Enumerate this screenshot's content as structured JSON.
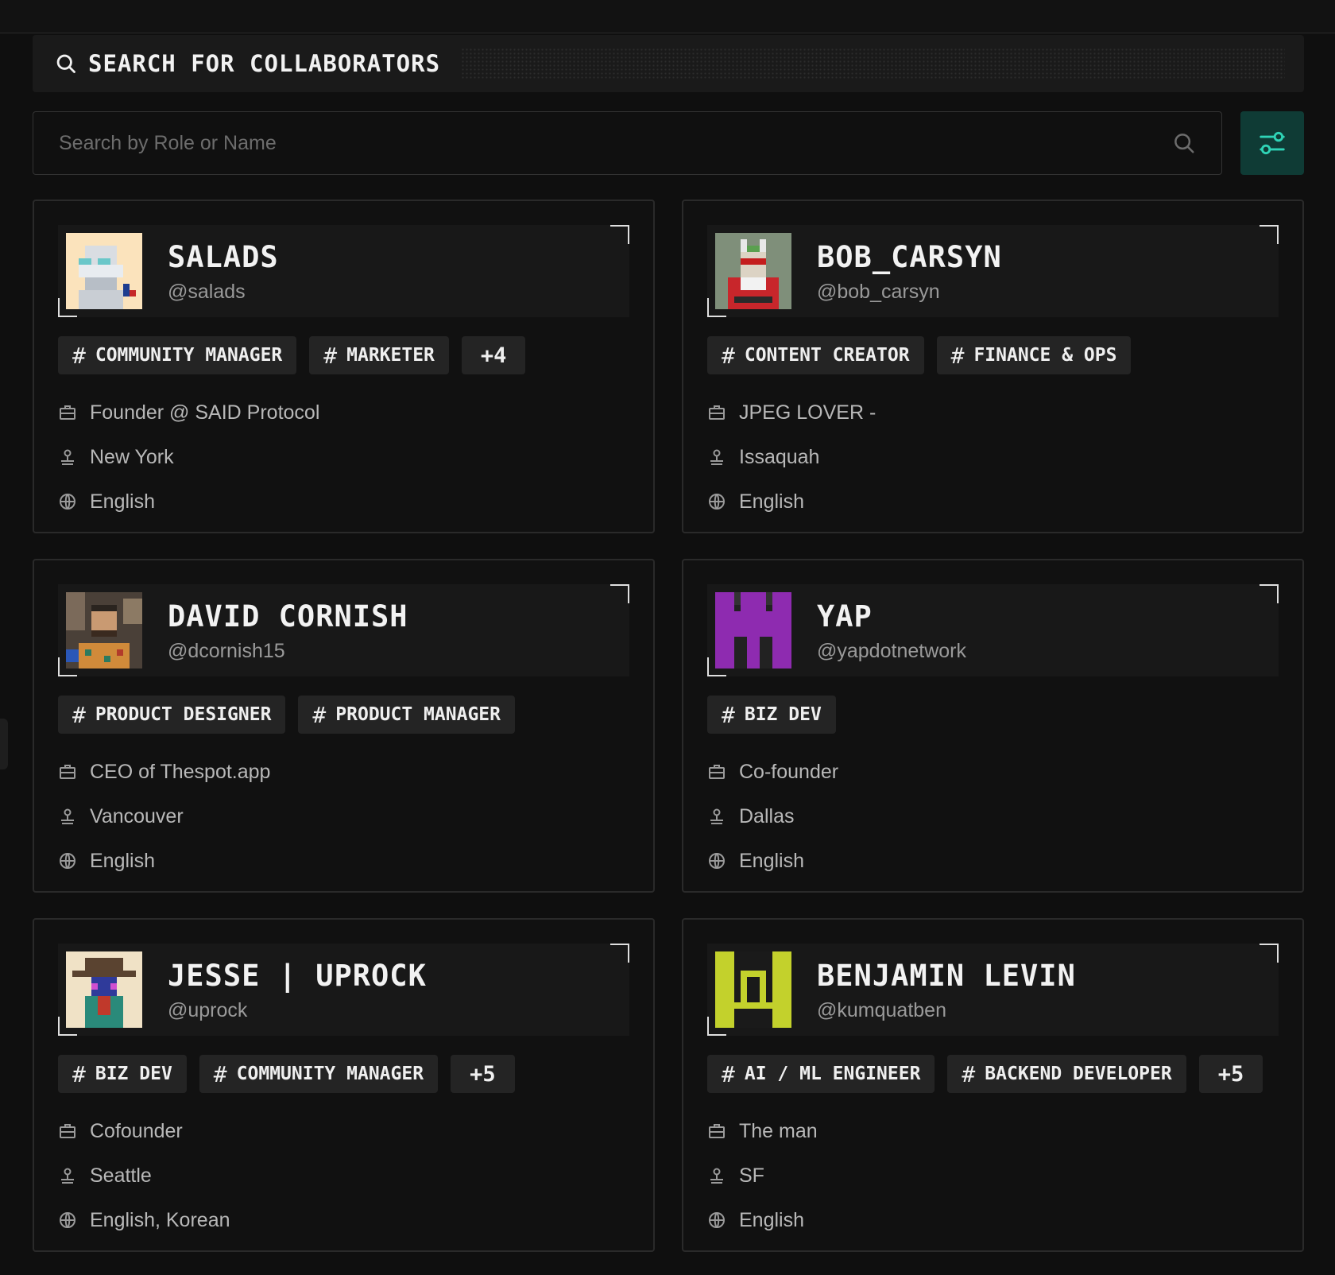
{
  "header": {
    "title": "SEARCH FOR COLLABORATORS",
    "icon": "search-icon"
  },
  "search": {
    "placeholder": "Search by Role or Name",
    "value": "",
    "icon": "search-icon"
  },
  "filter_button": {
    "icon": "sliders-icon",
    "color": "#0f3b35",
    "icon_color": "#2fd3b6"
  },
  "colors": {
    "background": "#0f0f0f",
    "card_border": "#2a2a2a",
    "tag_background": "#242424",
    "accent": "#0f3b35"
  },
  "cards": [
    {
      "name": "SALADS",
      "handle": "@salads",
      "tags": [
        "COMMUNITY MANAGER",
        "MARKETER"
      ],
      "more": "+4",
      "title": "Founder @ SAID Protocol",
      "location": "New York",
      "languages": "English"
    },
    {
      "name": "BOB_CARSYN",
      "handle": "@bob_carsyn",
      "tags": [
        "CONTENT CREATOR",
        "FINANCE & OPS"
      ],
      "more": "",
      "title": "JPEG LOVER -",
      "location": "Issaquah",
      "languages": "English"
    },
    {
      "name": "DAVID CORNISH",
      "handle": "@dcornish15",
      "tags": [
        "PRODUCT DESIGNER",
        "PRODUCT MANAGER"
      ],
      "more": "",
      "title": "CEO of Thespot.app",
      "location": "Vancouver",
      "languages": "English"
    },
    {
      "name": "YAP",
      "handle": "@yapdotnetwork",
      "tags": [
        "BIZ DEV"
      ],
      "more": "",
      "title": "Co-founder",
      "location": "Dallas",
      "languages": "English"
    },
    {
      "name": "JESSE | UPROCK",
      "handle": "@uprock",
      "tags": [
        "BIZ DEV",
        "COMMUNITY MANAGER"
      ],
      "more": "+5",
      "title": "Cofounder",
      "location": "Seattle",
      "languages": "English, Korean"
    },
    {
      "name": "BENJAMIN LEVIN",
      "handle": "@kumquatben",
      "tags": [
        "AI / ML ENGINEER",
        "BACKEND DEVELOPER"
      ],
      "more": "+5",
      "title": "The man",
      "location": "SF",
      "languages": "English"
    }
  ]
}
